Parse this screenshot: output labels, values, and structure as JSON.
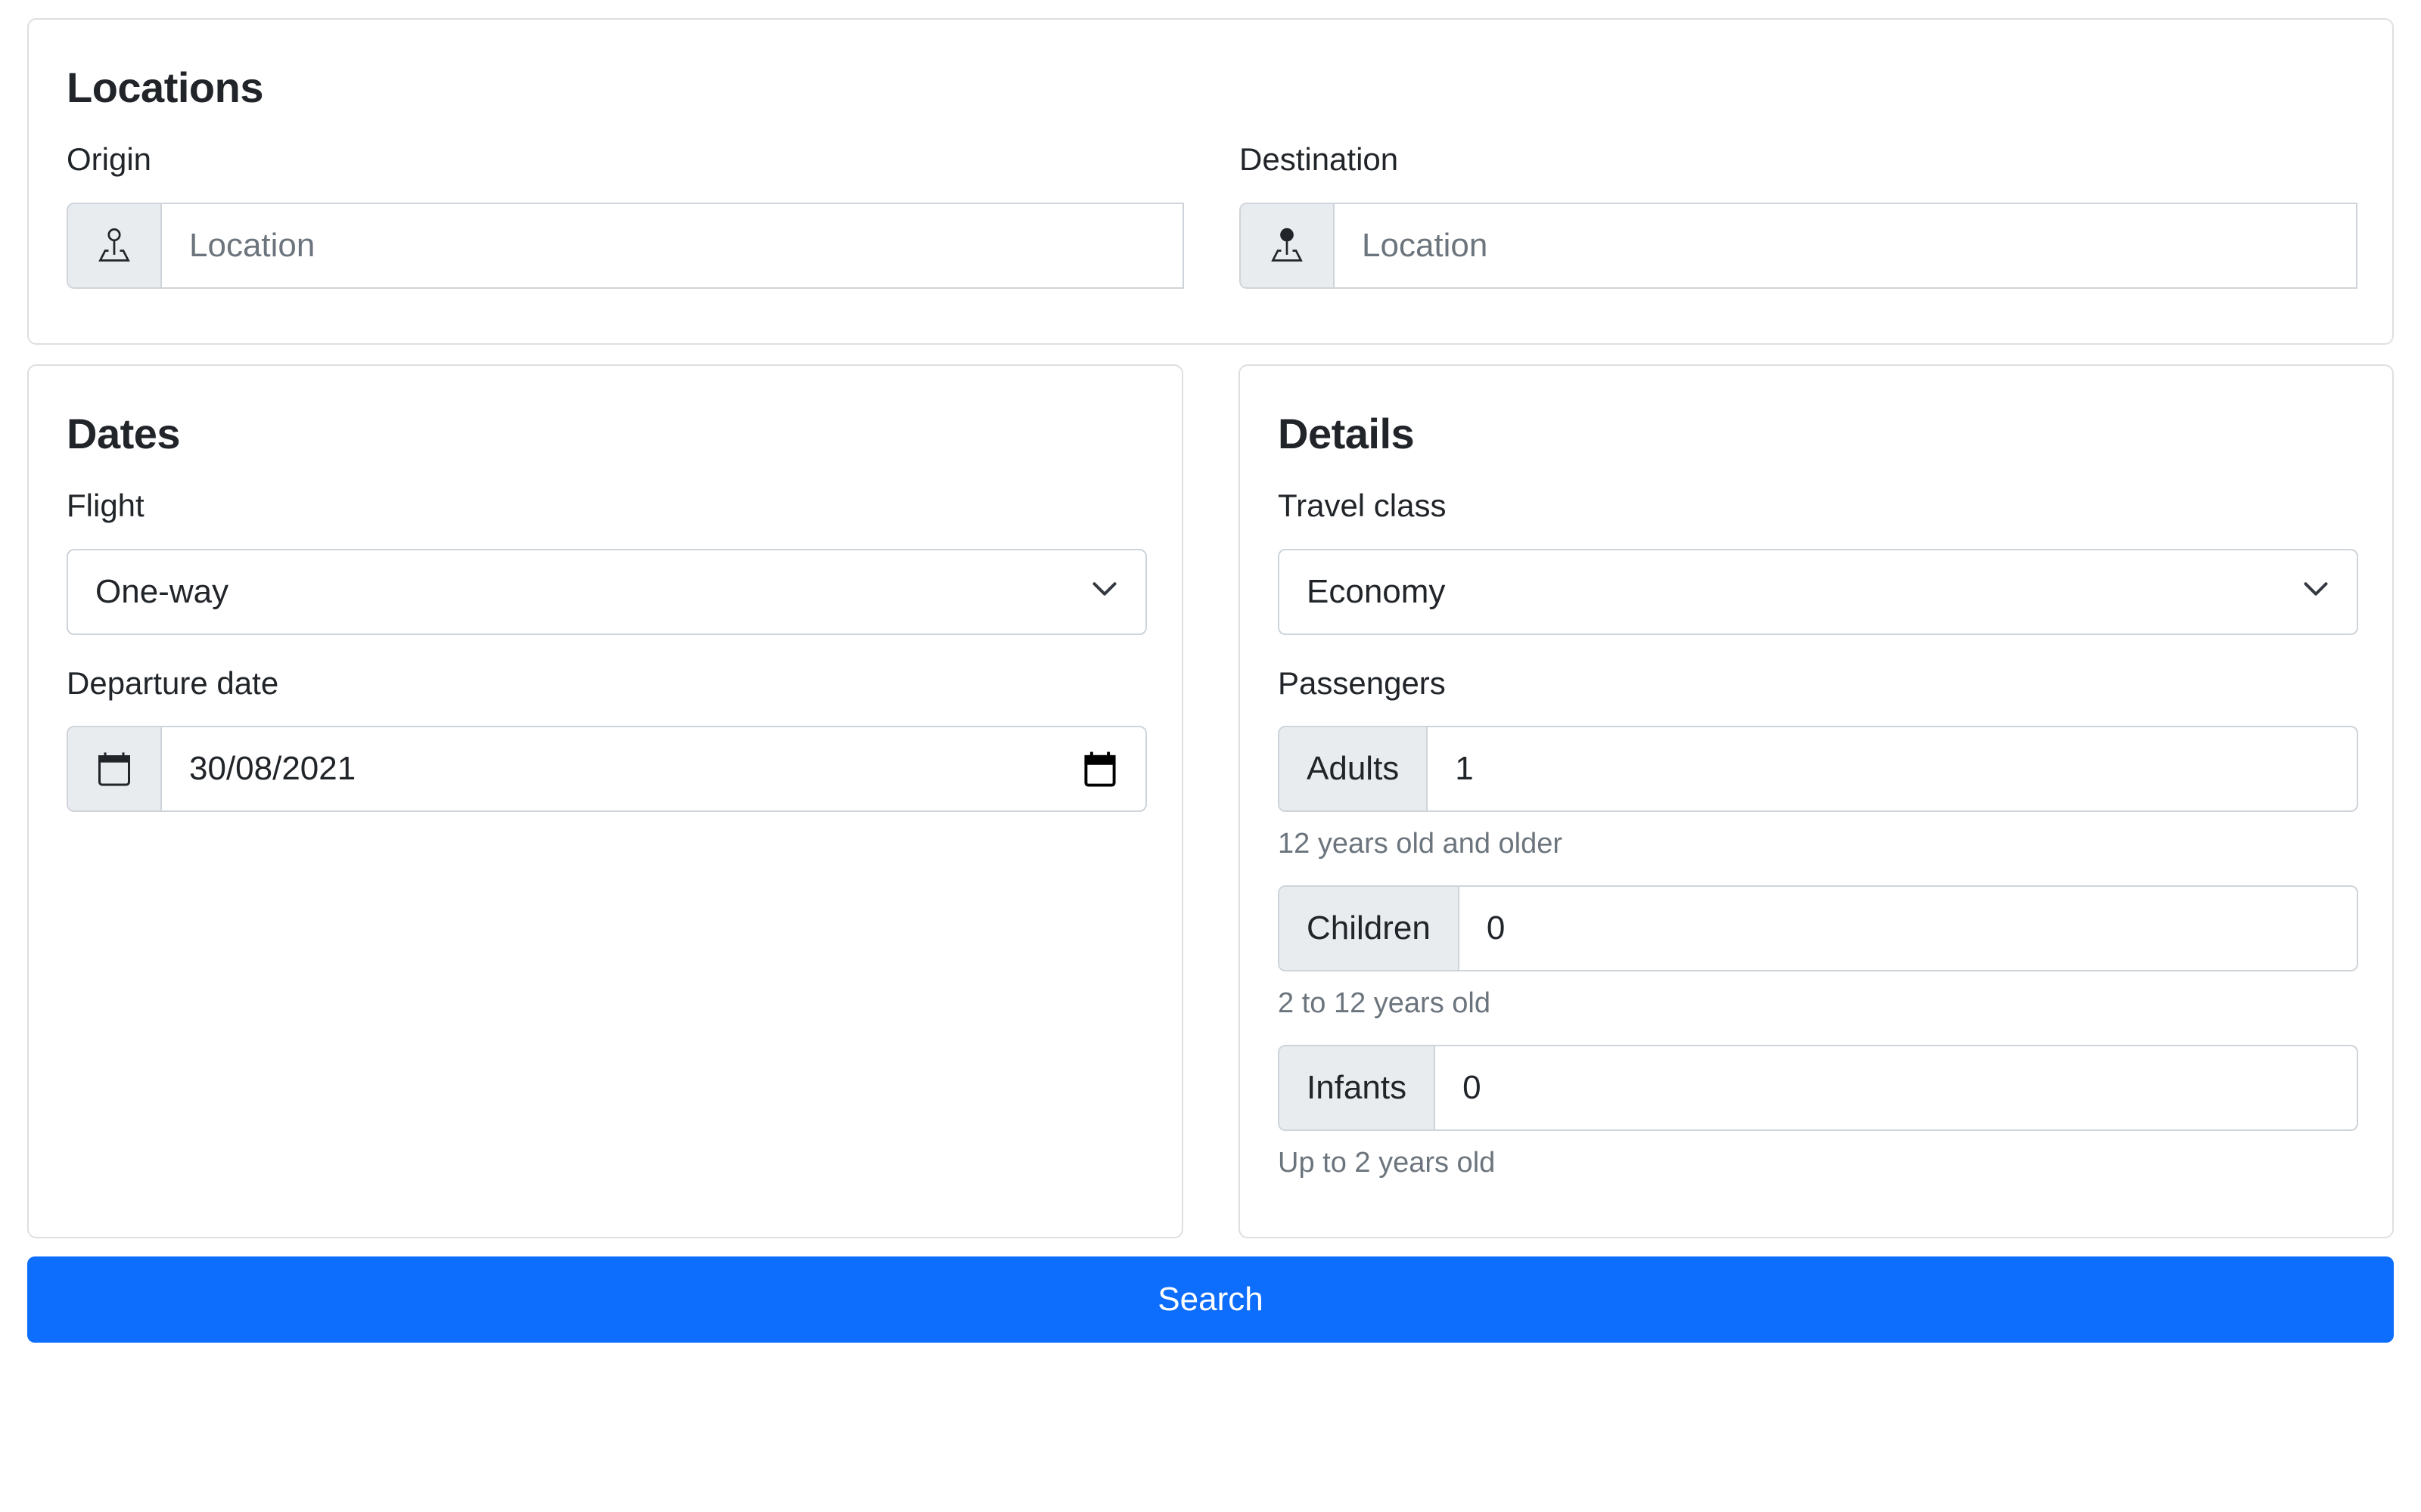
{
  "locations": {
    "title": "Locations",
    "origin": {
      "label": "Origin",
      "placeholder": "Location",
      "value": "",
      "icon": "pin-map-icon"
    },
    "destination": {
      "label": "Destination",
      "placeholder": "Location",
      "value": "",
      "icon": "pin-map-fill-icon"
    }
  },
  "dates": {
    "title": "Dates",
    "flight": {
      "label": "Flight",
      "selected": "One-way",
      "icon": "chevron-down-icon"
    },
    "departure": {
      "label": "Departure date",
      "value": "30/08/2021",
      "icon": "calendar-icon",
      "picker_icon": "calendar-fill-icon"
    }
  },
  "details": {
    "title": "Details",
    "travel_class": {
      "label": "Travel class",
      "selected": "Economy",
      "icon": "chevron-down-icon"
    },
    "passengers": {
      "label": "Passengers",
      "adults": {
        "label": "Adults",
        "value": "1",
        "help": "12 years old and older"
      },
      "children": {
        "label": "Children",
        "value": "0",
        "help": "2 to 12 years old"
      },
      "infants": {
        "label": "Infants",
        "value": "0",
        "help": "Up to 2 years old"
      }
    }
  },
  "search_button": {
    "label": "Search",
    "color": "#0d6efd"
  }
}
